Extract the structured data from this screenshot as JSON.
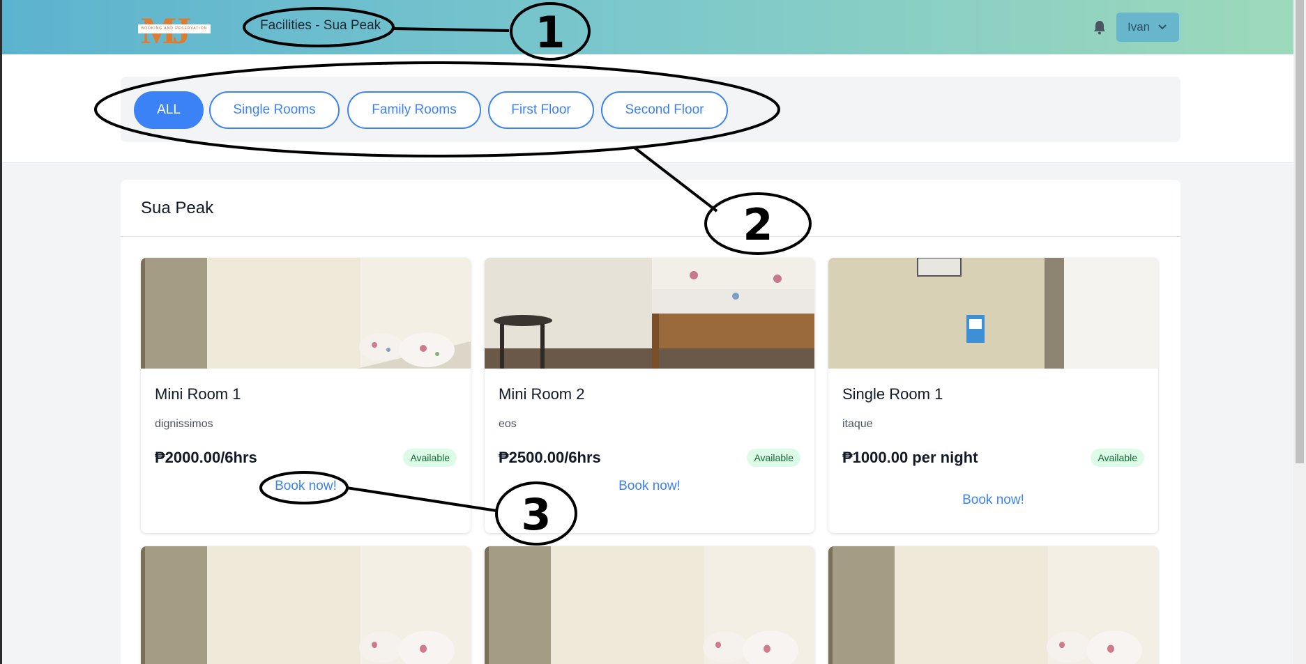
{
  "header": {
    "logo_text": "MJ",
    "logo_tagline": "BOOKING AND RESERVATION",
    "page_title": "Facilities - Sua Peak",
    "user_name": "Ivan",
    "bell_icon": "bell-icon",
    "chevron_icon": "chevron-down-icon"
  },
  "filters": [
    {
      "label": "ALL",
      "active": true
    },
    {
      "label": "Single Rooms",
      "active": false
    },
    {
      "label": "Family Rooms",
      "active": false
    },
    {
      "label": "First Floor",
      "active": false
    },
    {
      "label": "Second Floor",
      "active": false
    }
  ],
  "section": {
    "title": "Sua Peak"
  },
  "rooms": [
    {
      "name": "Mini Room 1",
      "desc": "dignissimos",
      "price": "₱2000.00/6hrs",
      "status": "Available",
      "book_label": "Book now!"
    },
    {
      "name": "Mini Room 2",
      "desc": "eos",
      "price": "₱2500.00/6hrs",
      "status": "Available",
      "book_label": "Book now!"
    },
    {
      "name": "Single Room 1",
      "desc": "itaque",
      "price": "₱1000.00 per night",
      "status": "Available",
      "book_label": "Book now!"
    }
  ],
  "annotations": [
    "1",
    "2",
    "3"
  ],
  "colors": {
    "accent": "#3b82f6",
    "header_gradient_start": "#5cb3cf",
    "header_gradient_end": "#9dd9bb",
    "badge_bg": "#dcfce7",
    "badge_text": "#166534"
  }
}
